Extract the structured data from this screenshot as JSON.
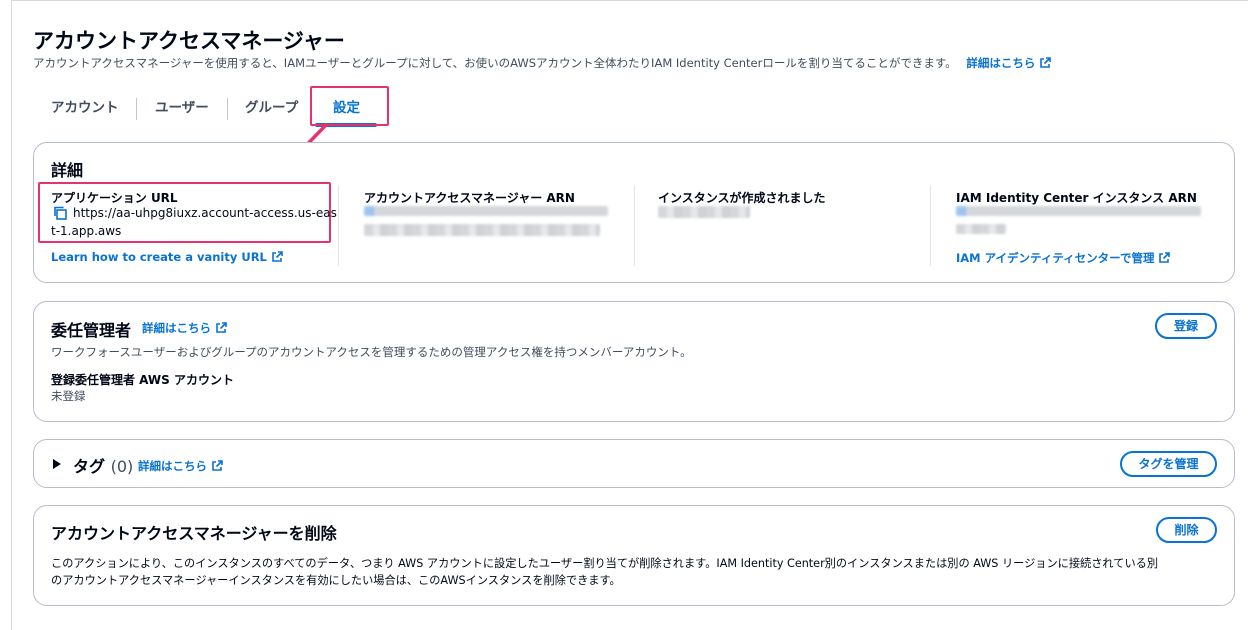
{
  "page": {
    "title": "アカウントアクセスマネージャー",
    "description": "アカウントアクセスマネージャーを使用すると、IAMユーザーとグループに対して、お使いのAWSアカウント全体わたりIAM Identity Centerロールを割り当てることができます。",
    "learn_more": "詳細はこちら"
  },
  "tabs": [
    {
      "label": "アカウント"
    },
    {
      "label": "ユーザー"
    },
    {
      "label": "グループ"
    },
    {
      "label": "設定"
    }
  ],
  "details": {
    "title": "詳細",
    "app_url_label": "アプリケーション URL",
    "app_url_line1": "https://aa-uhpg8iuxz.account-access.us-eas",
    "app_url_line2": "t-1.app.aws",
    "vanity_link": "Learn how to create a vanity URL",
    "arn_label": "アカウントアクセスマネージャー ARN",
    "created_label": "インスタンスが作成されました",
    "iam_arn_label": "IAM Identity Center インスタンス ARN",
    "iam_link": "IAM アイデンティティセンターで管理"
  },
  "delegated": {
    "title": "委任管理者",
    "learn_more": "詳細はこちら",
    "description": "ワークフォースユーザーおよびグループのアカウントアクセスを管理するための管理アクセス権を持つメンバーアカウント。",
    "field_label": "登録委任管理者 AWS アカウント",
    "field_value": "未登録",
    "button": "登録"
  },
  "tags": {
    "title": "タグ",
    "count": "(0)",
    "learn_more": "詳細はこちら",
    "button": "タグを管理"
  },
  "delete": {
    "title": "アカウントアクセスマネージャーを削除",
    "text_line1": "このアクションにより、このインスタンスのすべてのデータ、つまり AWS アカウントに設定したユーザー割り当てが削除されます。IAM Identity Center別のインスタンスまたは別の AWS リージョンに接続されている別",
    "text_line2": "のアカウントアクセスマネージャーインスタンスを有効にしたい場合は、このAWSインスタンスを削除できます。",
    "button": "削除"
  },
  "colors": {
    "link": "#0972d3",
    "highlight": "#e6336f",
    "text": "#000716"
  }
}
